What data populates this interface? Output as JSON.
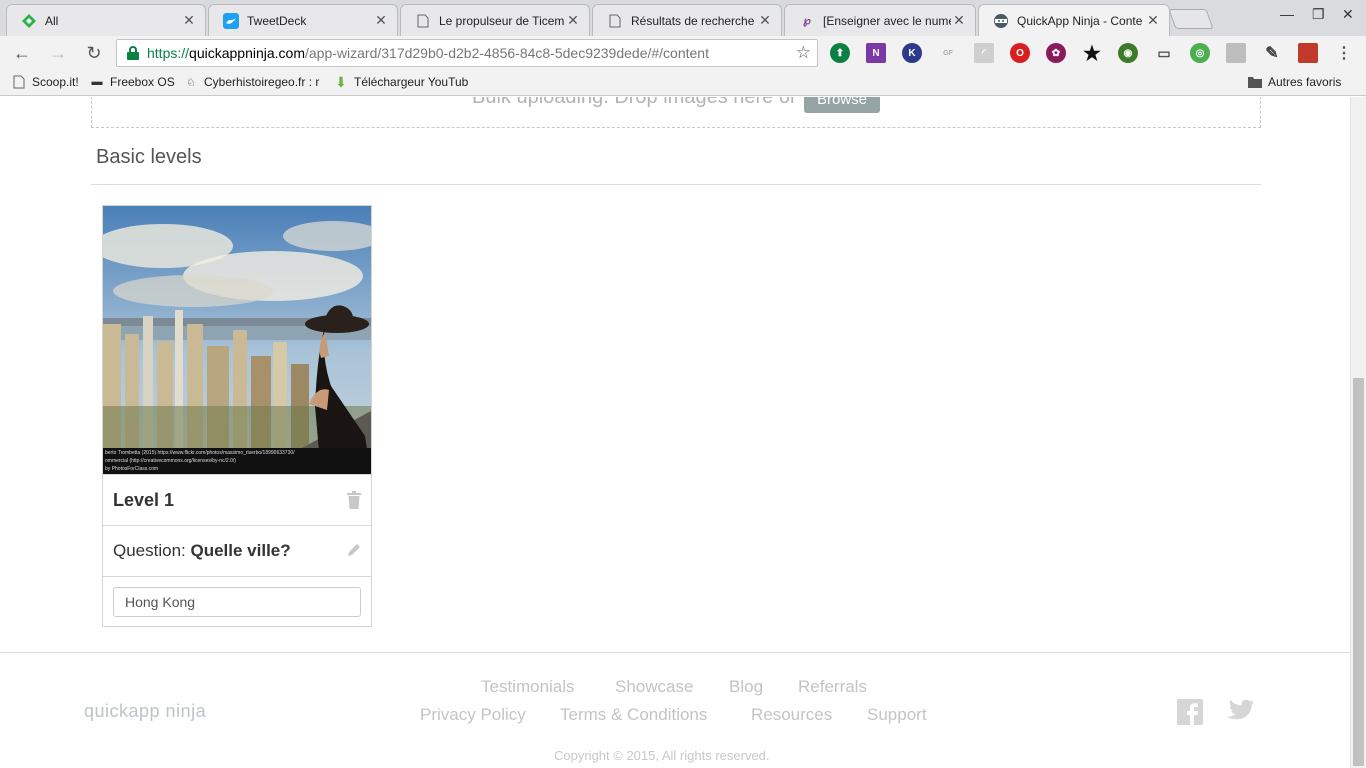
{
  "tabs": [
    {
      "title": "All",
      "favicon": "feedly-icon"
    },
    {
      "title": "TweetDeck",
      "favicon": "tweetdeck-icon"
    },
    {
      "title": "Le propulseur de Ticem",
      "favicon": "page-icon"
    },
    {
      "title": "Résultats de recherche",
      "favicon": "page-icon"
    },
    {
      "title": "[Enseigner avec le numé",
      "favicon": "site-icon"
    },
    {
      "title": "QuickApp Ninja - Conte",
      "favicon": "ninja-icon"
    }
  ],
  "omnibox": {
    "scheme": "https://",
    "host": "quickappninja.com",
    "path": "/app-wizard/317d29b0-d2b2-4856-84c8-5dec9239dede/#/content"
  },
  "bookmarks": [
    {
      "label": "Scoop.it!",
      "icon": "page-icon"
    },
    {
      "label": "Freebox OS",
      "icon": "freebox-icon"
    },
    {
      "label": "Cyberhistoiregeo.fr : r",
      "icon": "wolf-icon"
    },
    {
      "label": "Téléchargeur YouTub",
      "icon": "download-arrow-icon"
    }
  ],
  "other_bookmarks": "Autres favoris",
  "dropzone": {
    "text": "Bulk uploading. Drop images here or",
    "button": "Browse"
  },
  "section_title": "Basic levels",
  "level": {
    "title": "Level 1",
    "question_label": "Question:",
    "question_value": "Quelle ville?",
    "answer_value": "Hong Kong",
    "image_credit": [
      "berto Trombetta (2015) https://www.flickr.com/photos/massimo_riserbo/18990633730/",
      "ommercial (http://creativecommons.org/licenses/by-nc/2.0/)",
      "by PhotosForClass.com"
    ]
  },
  "footer": {
    "logo": "quickapp ninja",
    "links_row1": [
      "Testimonials",
      "Showcase",
      "Blog",
      "Referrals"
    ],
    "links_row2": [
      "Privacy Policy",
      "Terms & Conditions",
      "Resources",
      "Support"
    ],
    "copyright": "Copyright © 2015, All rights reserved."
  },
  "colors": {
    "secure": "#0b8043",
    "browse_button": "#95a5a6",
    "footer_text": "#c4c4c4"
  }
}
